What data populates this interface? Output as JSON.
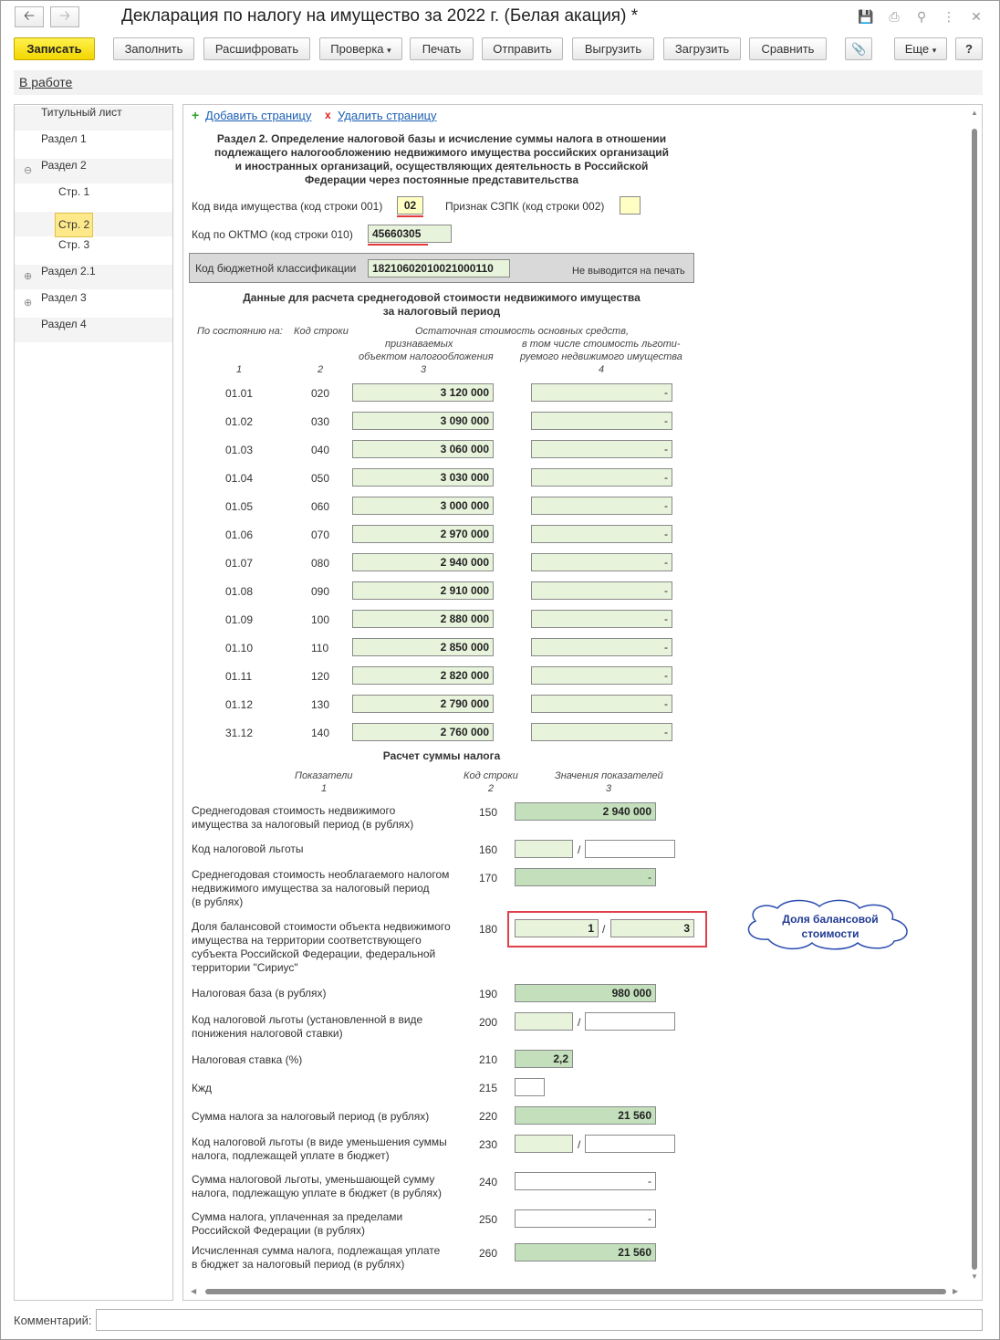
{
  "window": {
    "title": "Декларация по налогу на имущество за 2022 г. (Белая акация) *",
    "back_icon": "arrow-left-icon",
    "forward_icon": "arrow-right-icon"
  },
  "toolbar": {
    "save": "Записать",
    "fill": "Заполнить",
    "decode": "Расшифровать",
    "check": "Проверка",
    "print": "Печать",
    "send": "Отправить",
    "upload": "Выгрузить",
    "load": "Загрузить",
    "compare": "Сравнить",
    "more": "Еще",
    "help": "?"
  },
  "status": {
    "link": "В работе"
  },
  "tree": {
    "items": [
      {
        "label": "Титульный лист"
      },
      {
        "label": "Раздел 1"
      },
      {
        "label": "Раздел 2",
        "exp": "⊖"
      },
      {
        "label": "Стр. 1"
      },
      {
        "label": "Стр. 2"
      },
      {
        "label": "Стр. 3"
      },
      {
        "label": "Раздел 2.1",
        "exp": "⊕"
      },
      {
        "label": "Раздел 3",
        "exp": "⊕"
      },
      {
        "label": "Раздел 4"
      }
    ]
  },
  "form": {
    "add_page": "Добавить страницу",
    "delete_page": "Удалить страницу",
    "section_title": [
      "Раздел 2. Определение налоговой базы и исчисление суммы налога в отношении",
      "подлежащего налогообложению недвижимого имущества российских организаций",
      "и иностранных организаций, осуществляющих деятельность в Российской",
      "Федерации через постоянные представительства"
    ],
    "property_code_label": "Код вида имущества (код строки 001)",
    "property_code_value": "02",
    "szpk_label": "Признак СЗПК (код строки 002)",
    "oktmo_label": "Код по ОКТМО (код строки 010)",
    "oktmo_value": "45660305",
    "kbk_label": "Код бюджетной классификации",
    "kbk_value": "18210602010021000110",
    "kbk_note": "Не выводится на печать",
    "avg_title": [
      "Данные для расчета среднегодовой стоимости недвижимого имущества",
      "за налоговый период"
    ],
    "col_headers": {
      "c1": "По состоянию на:",
      "c2": "Код строки",
      "c3a": "Остаточная стоимость основных средств,",
      "c3b": "признаваемых",
      "c3c": "объектом налогообложения",
      "c4b": "в том числе стоимость льготи-",
      "c4c": "руемого недвижимого имущества",
      "n1": "1",
      "n2": "2",
      "n3": "3",
      "n4": "4"
    },
    "rows": [
      {
        "date": "01.01",
        "code": "020",
        "value": "3 120 000",
        "exempt": "-"
      },
      {
        "date": "01.02",
        "code": "030",
        "value": "3 090 000",
        "exempt": "-"
      },
      {
        "date": "01.03",
        "code": "040",
        "value": "3 060 000",
        "exempt": "-"
      },
      {
        "date": "01.04",
        "code": "050",
        "value": "3 030 000",
        "exempt": "-"
      },
      {
        "date": "01.05",
        "code": "060",
        "value": "3 000 000",
        "exempt": "-"
      },
      {
        "date": "01.06",
        "code": "070",
        "value": "2 970 000",
        "exempt": "-"
      },
      {
        "date": "01.07",
        "code": "080",
        "value": "2 940 000",
        "exempt": "-"
      },
      {
        "date": "01.08",
        "code": "090",
        "value": "2 910 000",
        "exempt": "-"
      },
      {
        "date": "01.09",
        "code": "100",
        "value": "2 880 000",
        "exempt": "-"
      },
      {
        "date": "01.10",
        "code": "110",
        "value": "2 850 000",
        "exempt": "-"
      },
      {
        "date": "01.11",
        "code": "120",
        "value": "2 820 000",
        "exempt": "-"
      },
      {
        "date": "01.12",
        "code": "130",
        "value": "2 790 000",
        "exempt": "-"
      },
      {
        "date": "31.12",
        "code": "140",
        "value": "2 760 000",
        "exempt": "-"
      }
    ],
    "calc_title": "Расчет суммы налога",
    "calc_headers": {
      "indicators": "Показатели",
      "code": "Код строки",
      "values": "Значения показателей",
      "n1": "1",
      "n2": "2",
      "n3": "3"
    },
    "calc": {
      "r150": {
        "label": [
          "Среднегодовая стоимость недвижимого",
          "имущества за налоговый период (в рублях)"
        ],
        "code": "150",
        "value": "2 940 000"
      },
      "r160": {
        "label": [
          "Код налоговой льготы"
        ],
        "code": "160",
        "slash": "/"
      },
      "r170": {
        "label": [
          "Среднегодовая стоимость необлагаемого налогом",
          "недвижимого имущества за налоговый период",
          "(в рублях)"
        ],
        "code": "170",
        "value": "-"
      },
      "r180": {
        "label": [
          "Доля балансовой стоимости объекта недвижимого",
          "имущества на территории соответствующего",
          "субъекта Российской Федерации, федеральной",
          "территории \"Сириус\""
        ],
        "code": "180",
        "num": "1",
        "den": "3",
        "slash": "/"
      },
      "r190": {
        "label": [
          "Налоговая база (в рублях)"
        ],
        "code": "190",
        "value": "980 000"
      },
      "r200": {
        "label": [
          "Код налоговой льготы (установленной в виде",
          "понижения налоговой ставки)"
        ],
        "code": "200",
        "slash": "/"
      },
      "r210": {
        "label": [
          "Налоговая ставка (%)"
        ],
        "code": "210",
        "value": "2,2"
      },
      "r215": {
        "label": [
          "Кжд"
        ],
        "code": "215"
      },
      "r220": {
        "label": [
          "Сумма налога за налоговый период (в рублях)"
        ],
        "code": "220",
        "value": "21 560"
      },
      "r230": {
        "label": [
          "Код налоговой льготы (в виде уменьшения суммы",
          "налога, подлежащей уплате в бюджет)"
        ],
        "code": "230",
        "slash": "/"
      },
      "r240": {
        "label": [
          "Сумма налоговой льготы, уменьшающей сумму",
          "налога, подлежащую уплате в бюджет (в рублях)"
        ],
        "code": "240",
        "value": "-"
      },
      "r250": {
        "label": [
          "Сумма налога, уплаченная за пределами",
          "Российской Федерации (в рублях)"
        ],
        "code": "250",
        "value": "-"
      },
      "r260": {
        "label": [
          "Исчисленная сумма налога, подлежащая уплате",
          "в бюджет за налоговый период (в рублях)"
        ],
        "code": "260",
        "value": "21 560"
      }
    },
    "callout": [
      "Доля балансовой",
      "стоимости"
    ]
  },
  "comment": {
    "label": "Комментарий:"
  },
  "colors": {
    "accent_yellow": "#f2d600",
    "green_field": "#e8f3dc",
    "dark_green_field": "#c3dfbc",
    "callout_text": "#1f3a93",
    "highlight_red": "#e0404a"
  }
}
